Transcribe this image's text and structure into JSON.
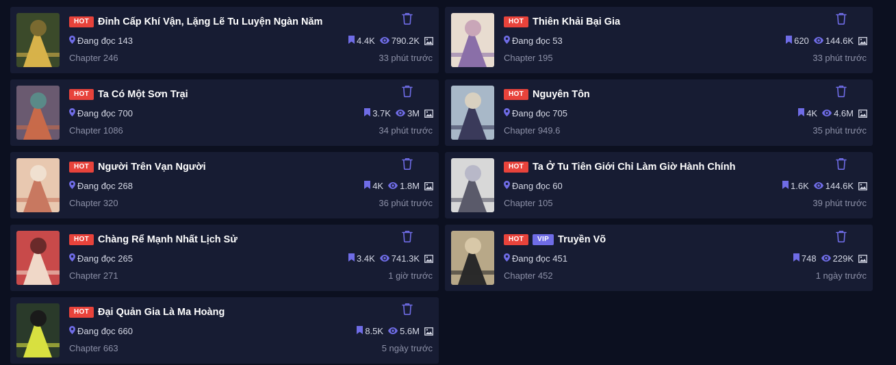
{
  "badges": {
    "hot": "HOT",
    "vip": "VIP"
  },
  "colors": {
    "background": "#0c1020",
    "card": "#171c33",
    "accent": "#6f6ce6",
    "hot": "#e8433b"
  },
  "icons": {
    "delete": "trash-icon",
    "reading": "location-pin-icon",
    "follows": "bookmark-icon",
    "views": "eye-icon",
    "image": "image-icon"
  },
  "items": [
    {
      "title": "Đỉnh Cấp Khí Vận, Lặng Lẽ Tu Luyện Ngàn Năm",
      "hot": true,
      "vip": false,
      "reading": "Đang đọc 143",
      "follows": "4.4K",
      "views": "790.2K",
      "chapter": "Chapter 246",
      "time": "33 phút trước",
      "cover": [
        "#3b4a2a",
        "#d7b24a",
        "#7a6a30"
      ]
    },
    {
      "title": "Thiên Khải Bại Gia",
      "hot": true,
      "vip": false,
      "reading": "Đang đọc 53",
      "follows": "620",
      "views": "144.6K",
      "chapter": "Chapter 195",
      "time": "33 phút trước",
      "cover": [
        "#e8dcd0",
        "#8a6fa8",
        "#c9a6b8"
      ]
    },
    {
      "title": "Ta Có Một Sơn Trại",
      "hot": true,
      "vip": false,
      "reading": "Đang đọc 700",
      "follows": "3.7K",
      "views": "3M",
      "chapter": "Chapter 1086",
      "time": "34 phút trước",
      "cover": [
        "#6a5a70",
        "#c86a4a",
        "#5a8a88"
      ]
    },
    {
      "title": "Nguyên Tôn",
      "hot": true,
      "vip": false,
      "reading": "Đang đọc 705",
      "follows": "4K",
      "views": "4.6M",
      "chapter": "Chapter 949.6",
      "time": "35 phút trước",
      "cover": [
        "#a8b8c8",
        "#3a3a5a",
        "#d8d0c0"
      ]
    },
    {
      "title": "Người Trên Vạn Người",
      "hot": true,
      "vip": false,
      "reading": "Đang đọc 268",
      "follows": "4K",
      "views": "1.8M",
      "chapter": "Chapter 320",
      "time": "36 phút trước",
      "cover": [
        "#e8c8b0",
        "#c87860",
        "#f0e0d0"
      ]
    },
    {
      "title": "Ta Ở Tu Tiên Giới Chỉ Làm Giờ Hành Chính",
      "hot": true,
      "vip": false,
      "reading": "Đang đọc 60",
      "follows": "1.6K",
      "views": "144.6K",
      "chapter": "Chapter 105",
      "time": "39 phút trước",
      "cover": [
        "#d8d8d8",
        "#5a5a6a",
        "#b8b8c8"
      ]
    },
    {
      "title": "Chàng Rể Mạnh Nhất Lịch Sử",
      "hot": true,
      "vip": false,
      "reading": "Đang đọc 265",
      "follows": "3.4K",
      "views": "741.3K",
      "chapter": "Chapter 271",
      "time": "1 giờ trước",
      "cover": [
        "#c84a4a",
        "#f0d8c8",
        "#6a2a2a"
      ]
    },
    {
      "title": "Truyền Võ",
      "hot": true,
      "vip": true,
      "reading": "Đang đọc 451",
      "follows": "748",
      "views": "229K",
      "chapter": "Chapter 452",
      "time": "1 ngày trước",
      "cover": [
        "#b8a888",
        "#2a2a2a",
        "#d8c8a8"
      ]
    },
    {
      "title": "Đại Quản Gia Là Ma Hoàng",
      "hot": true,
      "vip": false,
      "reading": "Đang đọc 660",
      "follows": "8.5K",
      "views": "5.6M",
      "chapter": "Chapter 663",
      "time": "5 ngày trước",
      "cover": [
        "#2a3a2a",
        "#d8e040",
        "#1a1a1a"
      ]
    }
  ]
}
